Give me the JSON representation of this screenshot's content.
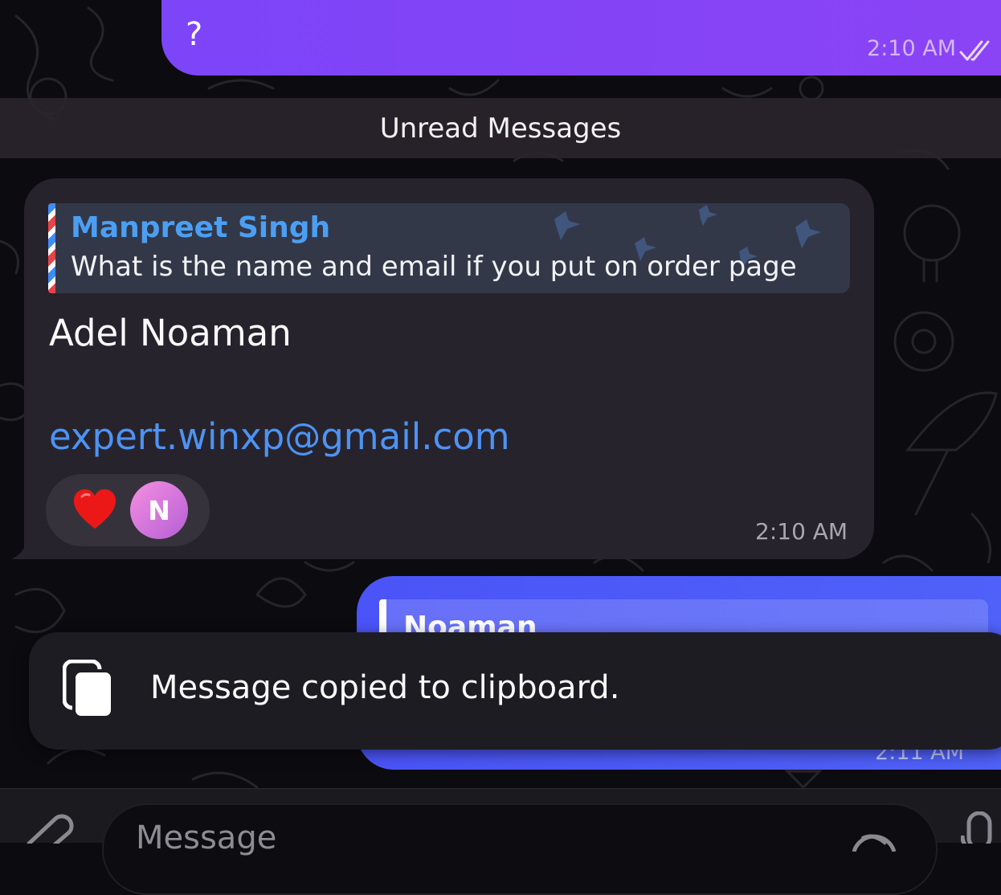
{
  "top_message": {
    "text": "?",
    "time": "2:10 AM",
    "status_icon": "double-check-icon"
  },
  "divider": {
    "label": "Unread Messages"
  },
  "incoming_message": {
    "reply": {
      "author": "Manpreet Singh",
      "text": "What is the name and email if you put on order page"
    },
    "lines": {
      "name": "Adel Noaman",
      "email": "expert.winxp@gmail.com"
    },
    "reaction": {
      "emoji_icon": "red-heart-icon",
      "reactor_initial": "N"
    },
    "time": "2:10 AM"
  },
  "outgoing_message": {
    "reply_author": "Noaman",
    "time": "2:11 AM"
  },
  "toast": {
    "icon": "copy-icon",
    "text": "Message copied to clipboard."
  },
  "input_bar": {
    "placeholder": "Message",
    "left_icon": "paperclip-icon",
    "inner_icon": "sticker-icon",
    "right_icon": "microphone-icon"
  },
  "colors": {
    "outgoing_top": "#8344f6",
    "outgoing_bottom": "#4d5af8",
    "incoming_bubble": "#27232d",
    "reply_author": "#4b9ff3",
    "link": "#4d93f3",
    "background": "#0c0b10"
  }
}
